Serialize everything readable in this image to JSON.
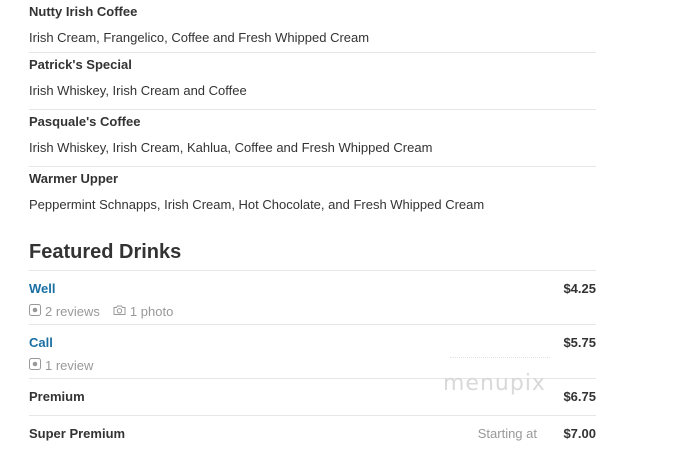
{
  "menu_items": [
    {
      "name": "Nutty Irish Coffee",
      "description": "Irish Cream, Frangelico, Coffee and Fresh Whipped Cream"
    },
    {
      "name": "Patrick's Special",
      "description": "Irish Whiskey, Irish Cream and Coffee"
    },
    {
      "name": "Pasquale's Coffee",
      "description": "Irish Whiskey, Irish Cream, Kahlua, Coffee and Fresh Whipped Cream"
    },
    {
      "name": "Warmer Upper",
      "description": "Peppermint Schnapps, Irish Cream, Hot Chocolate, and Fresh Whipped Cream"
    }
  ],
  "featured": {
    "heading": "Featured Drinks",
    "drinks": [
      {
        "name": "Well",
        "price": "$4.25",
        "reviews": "2 reviews",
        "photos": "1 photo"
      },
      {
        "name": "Call",
        "price": "$5.75",
        "reviews": "1 review"
      },
      {
        "name": "Premium",
        "price": "$6.75"
      },
      {
        "name": "Super Premium",
        "price": "$7.00",
        "starting_at": "Starting at"
      }
    ]
  },
  "watermark": "menupix",
  "colors": {
    "link": "#1a6fa3",
    "muted": "#999999",
    "text": "#333333",
    "divider": "#e6e6e6"
  }
}
